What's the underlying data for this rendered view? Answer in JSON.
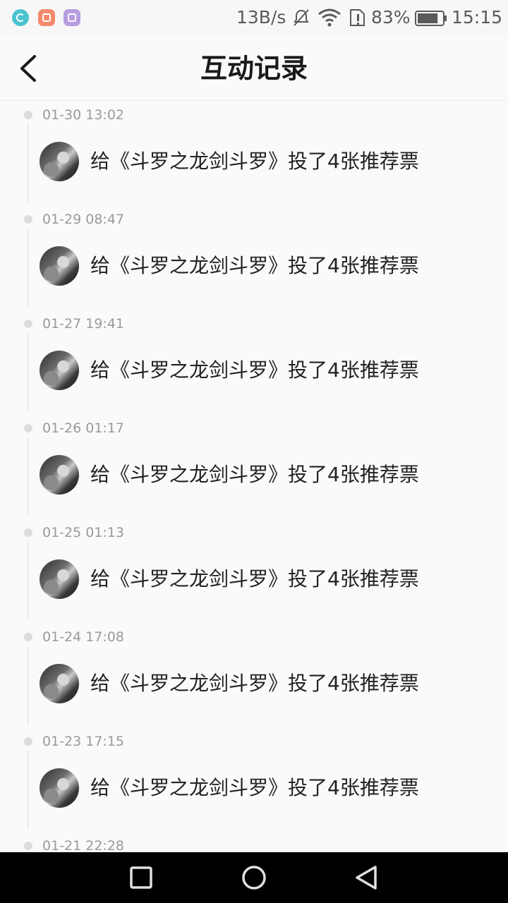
{
  "status_bar": {
    "network_speed": "13B/s",
    "battery_percent": "83%",
    "time": "15:15",
    "battery_level": 0.83,
    "icons": [
      "moon-app-icon",
      "mail-app-icon",
      "gallery-app-icon",
      "mute-icon",
      "wifi-icon",
      "sim-alert-icon",
      "battery-icon"
    ]
  },
  "header": {
    "back_icon": "chevron-left-icon",
    "title": "互动记录"
  },
  "records": [
    {
      "time": "01-30 13:02",
      "text": "给《斗罗之龙剑斗罗》投了4张推荐票"
    },
    {
      "time": "01-29 08:47",
      "text": "给《斗罗之龙剑斗罗》投了4张推荐票"
    },
    {
      "time": "01-27 19:41",
      "text": "给《斗罗之龙剑斗罗》投了4张推荐票"
    },
    {
      "time": "01-26 01:17",
      "text": "给《斗罗之龙剑斗罗》投了4张推荐票"
    },
    {
      "time": "01-25 01:13",
      "text": "给《斗罗之龙剑斗罗》投了4张推荐票"
    },
    {
      "time": "01-24 17:08",
      "text": "给《斗罗之龙剑斗罗》投了4张推荐票"
    },
    {
      "time": "01-23 17:15",
      "text": "给《斗罗之龙剑斗罗》投了4张推荐票"
    },
    {
      "time": "01-21 22:28",
      "text": ""
    }
  ],
  "nav_bar": {
    "icons": [
      "recent-apps-icon",
      "home-icon",
      "back-icon"
    ]
  },
  "colors": {
    "background": "#fafafa",
    "title": "#1a1a1a",
    "timestamp": "#9a9a9a",
    "record_text": "#222222",
    "timeline": "#e8e8e8",
    "nav_bar": "#000000"
  }
}
